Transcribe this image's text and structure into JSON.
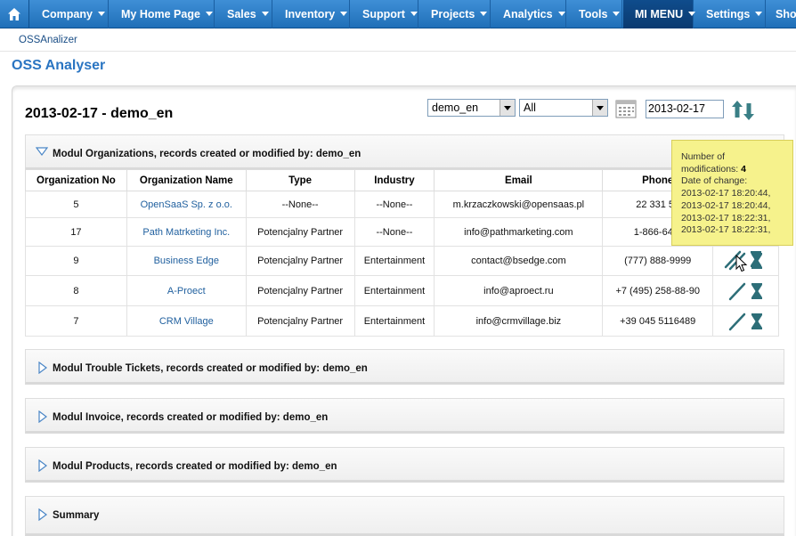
{
  "nav": {
    "items": [
      {
        "label": "Company",
        "active": false
      },
      {
        "label": "My Home Page",
        "active": false
      },
      {
        "label": "Sales",
        "active": false
      },
      {
        "label": "Inventory",
        "active": false
      },
      {
        "label": "Support",
        "active": false
      },
      {
        "label": "Projects",
        "active": false
      },
      {
        "label": "Analytics",
        "active": false
      },
      {
        "label": "Tools",
        "active": false
      },
      {
        "label": "MI MENU",
        "active": true
      },
      {
        "label": "Settings",
        "active": false
      },
      {
        "label": "Sho",
        "active": false
      }
    ]
  },
  "breadcrumb": "OSSAnalizer",
  "page_title": "OSS Analyser",
  "report": {
    "title": "2013-02-17 - demo_en",
    "user_select": "demo_en",
    "type_select": "All",
    "date": "2013-02-17"
  },
  "sections": {
    "organizations": "Modul Organizations, records created or modified by: demo_en",
    "trouble_tickets": "Modul Trouble Tickets, records created or modified by: demo_en",
    "invoice": "Modul Invoice, records created or modified by: demo_en",
    "products": "Modul Products, records created or modified by: demo_en",
    "summary": "Summary"
  },
  "table": {
    "headers": [
      "Organization No",
      "Organization Name",
      "Type",
      "Industry",
      "Email",
      "Phone"
    ],
    "rows": [
      {
        "no": "5",
        "name": "OpenSaaS Sp. z o.o.",
        "type": "--None--",
        "industry": "--None--",
        "email": "m.krzaczkowski@opensaas.pl",
        "phone": "22 331 57"
      },
      {
        "no": "17",
        "name": "Path Matrketing Inc.",
        "type": "Potencjalny Partner",
        "industry": "--None--",
        "email": "info@pathmarketing.com",
        "phone": "1-866-642-"
      },
      {
        "no": "9",
        "name": "Business Edge",
        "type": "Potencjalny Partner",
        "industry": "Entertainment",
        "email": "contact@bsedge.com",
        "phone": "(777) 888-9999"
      },
      {
        "no": "8",
        "name": "A-Proect",
        "type": "Potencjalny Partner",
        "industry": "Entertainment",
        "email": "info@aproect.ru",
        "phone": "+7 (495) 258-88-90"
      },
      {
        "no": "7",
        "name": "CRM Village",
        "type": "Potencjalny Partner",
        "industry": "Entertainment",
        "email": "info@crmvillage.biz",
        "phone": "+39 045 5116489"
      }
    ]
  },
  "tooltip": {
    "line1": "Number of",
    "line2_label": "modifications:",
    "line2_value": "4",
    "line3": "Date of change:",
    "dates": [
      "2013-02-17 18:20:44,",
      "2013-02-17 18:20:44,",
      "2013-02-17 18:22:31,",
      "2013-02-17 18:22:31,"
    ]
  },
  "colors": {
    "nav_blue": "#2a7fcc",
    "link_blue": "#1f5f9e",
    "title_blue": "#2a75c2",
    "tooltip_bg": "#f6f28c",
    "icon_teal": "#2d6e78"
  }
}
